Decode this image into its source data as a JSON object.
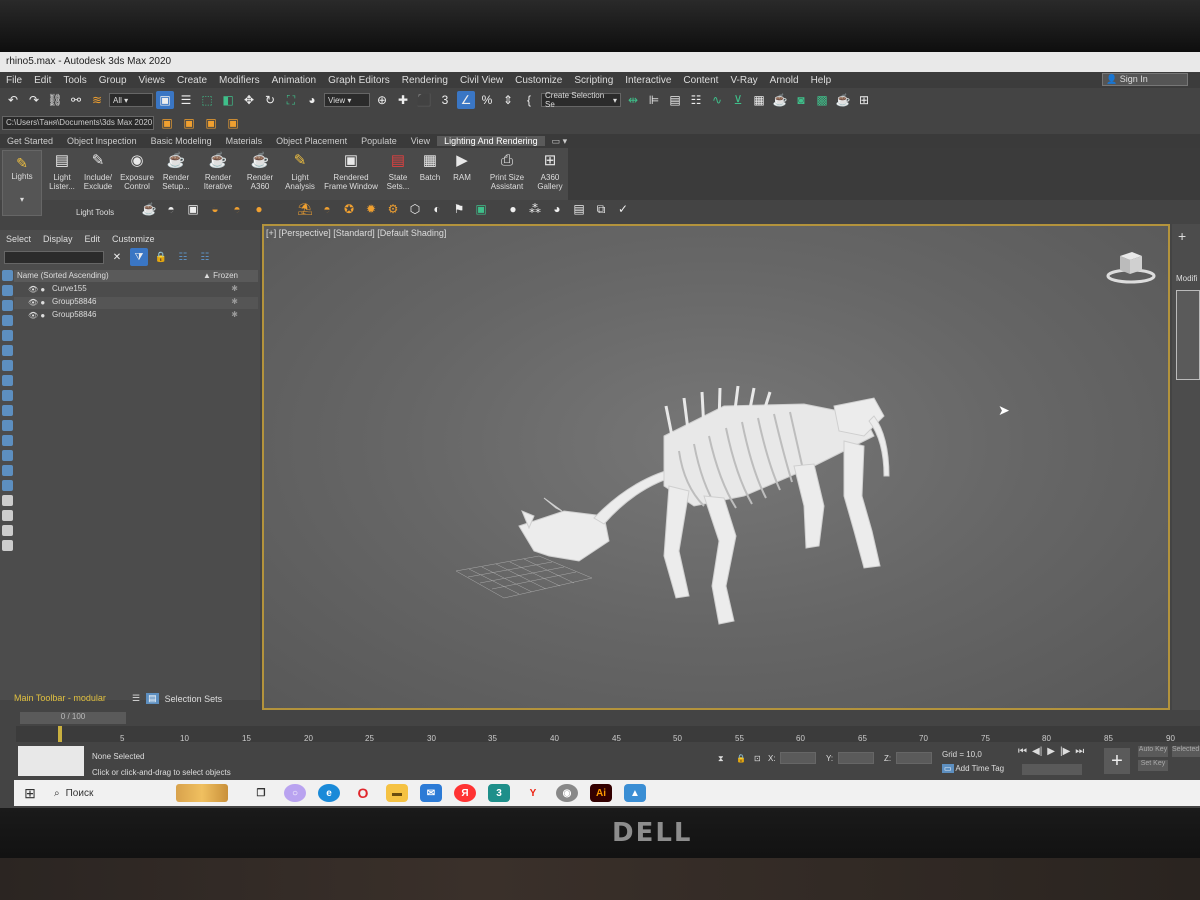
{
  "window": {
    "title": "rhino5.max - Autodesk 3ds Max 2020"
  },
  "menu": [
    "File",
    "Edit",
    "Tools",
    "Group",
    "Views",
    "Create",
    "Modifiers",
    "Animation",
    "Graph Editors",
    "Rendering",
    "Civil View",
    "Customize",
    "Scripting",
    "Interactive",
    "Content",
    "V-Ray",
    "Arnold",
    "Help"
  ],
  "signin": "Sign In",
  "toolbar": {
    "filter": "All",
    "refcoord": "View",
    "selection_set": "Create Selection Se",
    "path": "C:\\Users\\Таня\\Documents\\3ds Max 2020"
  },
  "ribbon_tabs": [
    "Get Started",
    "Object Inspection",
    "Basic Modeling",
    "Materials",
    "Object Placement",
    "Populate",
    "View",
    "Lighting And Rendering"
  ],
  "ribbon": {
    "lights": "Lights",
    "buttons": [
      {
        "l1": "Light",
        "l2": "Lister..."
      },
      {
        "l1": "Include/",
        "l2": "Exclude"
      },
      {
        "l1": "Exposure",
        "l2": "Control"
      },
      {
        "l1": "Render",
        "l2": "Setup..."
      },
      {
        "l1": "Render",
        "l2": "Iterative"
      },
      {
        "l1": "Render",
        "l2": "A360"
      },
      {
        "l1": "Light",
        "l2": "Analysis"
      },
      {
        "l1": "Rendered",
        "l2": "Frame Window"
      },
      {
        "l1": "State",
        "l2": "Sets..."
      },
      {
        "l1": "Batch",
        "l2": ""
      },
      {
        "l1": "RAM",
        "l2": ""
      },
      {
        "l1": "Print Size",
        "l2": "Assistant"
      },
      {
        "l1": "A360",
        "l2": "Gallery"
      }
    ],
    "group_label": "Light Tools"
  },
  "scene_explorer": {
    "menu": [
      "Select",
      "Display",
      "Edit",
      "Customize"
    ],
    "header_name": "Name (Sorted Ascending)",
    "header_frozen": "▲ Frozen",
    "rows": [
      "Curve155",
      "Group58846",
      "Group58846"
    ]
  },
  "viewport": {
    "label": "[+] [Perspective] [Standard] [Default Shading]"
  },
  "command_panel": {
    "label": "Modifi"
  },
  "bottom": {
    "main_toolbar": "Main Toolbar - modular",
    "selection_sets": "Selection Sets",
    "frame": "0 / 100",
    "ticks": [
      "5",
      "10",
      "15",
      "20",
      "25",
      "30",
      "35",
      "40",
      "45",
      "50",
      "55",
      "60",
      "65",
      "70",
      "75",
      "80",
      "85",
      "90"
    ],
    "none_selected": "None Selected",
    "hint": "Click or click-and-drag to select objects",
    "x_label": "X:",
    "y_label": "Y:",
    "z_label": "Z:",
    "grid": "Grid = 10,0",
    "time_tag": "Add Time Tag",
    "auto_key": "Auto Key",
    "set_key": "Set Key",
    "selected": "Selected"
  },
  "taskbar": {
    "search": "Поиск",
    "ai": "Ai"
  },
  "monitor_brand": "DELL"
}
